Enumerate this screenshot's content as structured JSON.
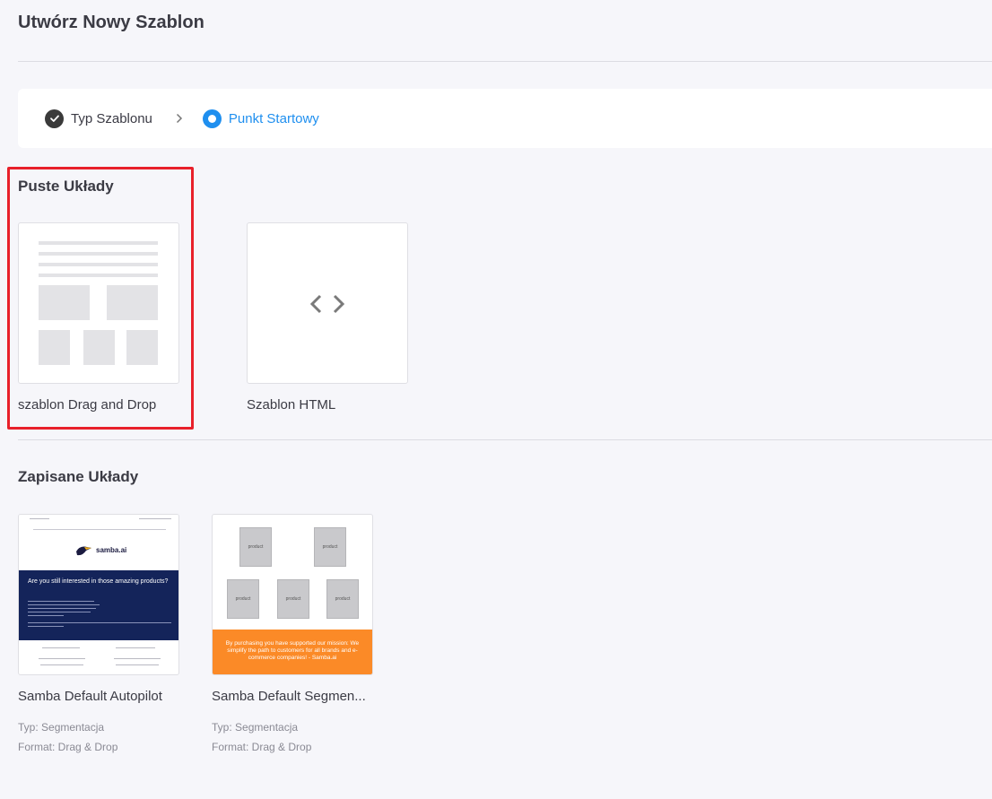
{
  "page": {
    "title": "Utwórz Nowy Szablon"
  },
  "stepper": {
    "step1": "Typ Szablonu",
    "step2": "Punkt Startowy"
  },
  "blank_layouts": {
    "title": "Puste Układy",
    "cards": [
      {
        "label": "szablon Drag and Drop",
        "icon": "grid-layout-preview"
      },
      {
        "label": "Szablon HTML",
        "icon": "code-icon"
      }
    ]
  },
  "saved_layouts": {
    "title": "Zapisane Układy",
    "cards": [
      {
        "label": "Samba Default Autopilot",
        "type": "Typ: Segmentacja",
        "format": "Format: Drag & Drop",
        "thumb": {
          "brand": "samba.ai",
          "heading": "Are you still interested in those amazing products?"
        }
      },
      {
        "label": "Samba Default Segmen...",
        "type": "Typ: Segmentacja",
        "format": "Format: Drag & Drop",
        "thumb": {
          "product": "product",
          "footer": "By purchasing you have supported our mission: We simplify the path to customers for all brands and e-commerce companies! - Samba.ai"
        }
      }
    ]
  },
  "colors": {
    "accent": "#1f8fef",
    "highlight": "#e8202a",
    "navy": "#14245a",
    "orange": "#fb8a27"
  }
}
